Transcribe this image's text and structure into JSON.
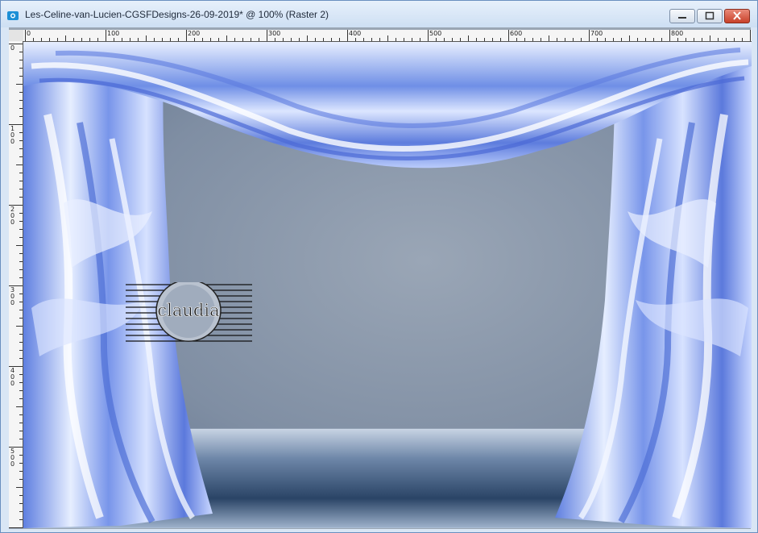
{
  "window": {
    "title": "Les-Celine-van-Lucien-CGSFDesigns-26-09-2019* @ 100% (Raster 2)",
    "controls": [
      "minimize",
      "maximize",
      "close"
    ]
  },
  "ruler": {
    "horizontal_labels": [
      "0",
      "100",
      "200",
      "300",
      "400",
      "500",
      "600",
      "700",
      "800"
    ],
    "vertical_labels": [
      "0",
      "100",
      "200",
      "300",
      "400",
      "500"
    ]
  },
  "canvas": {
    "image": "stage with blue curtains",
    "watermark_text": "claudia",
    "colors": {
      "curtain": "#6f8fe8",
      "curtain_light": "#dbe6ff",
      "backdrop": "#8a98aa",
      "floor": "#2d4a6e",
      "title_bar": "#d6e4f5"
    }
  }
}
